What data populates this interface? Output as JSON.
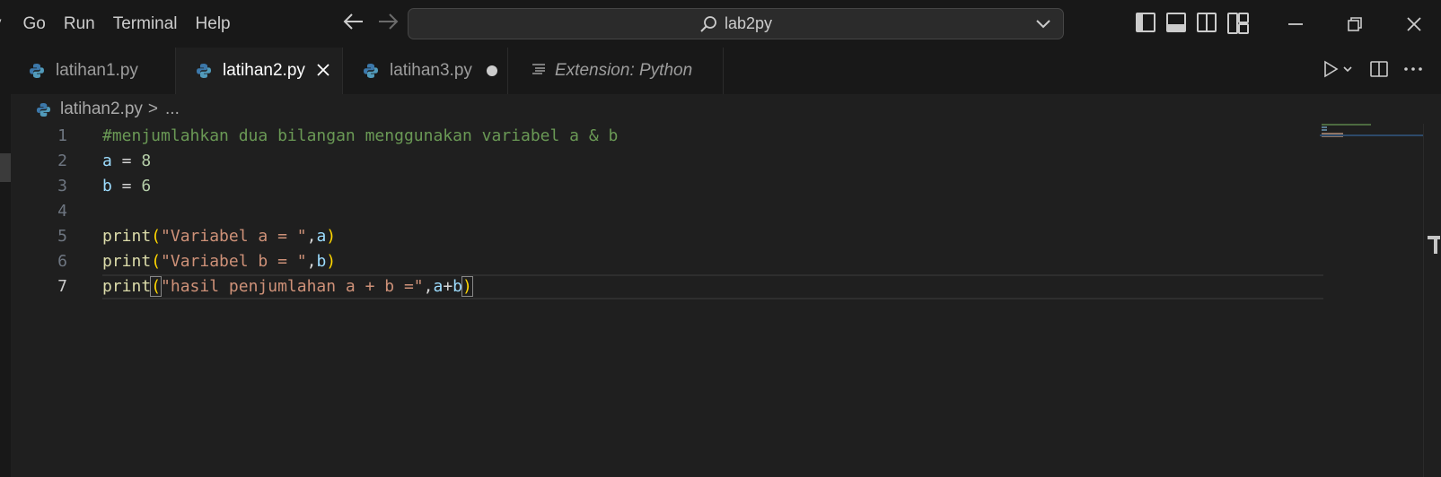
{
  "menu": {
    "items": [
      "y",
      "Go",
      "Run",
      "Terminal",
      "Help"
    ]
  },
  "nav": {
    "back_icon": "arrow-left-icon",
    "forward_icon": "arrow-right-icon"
  },
  "command_center": {
    "text": "lab2py",
    "icon": "search-icon"
  },
  "tabs": [
    {
      "label": "latihan1.py",
      "icon": "python-icon",
      "active": false
    },
    {
      "label": "latihan2.py",
      "icon": "python-icon",
      "active": true,
      "close": "×"
    },
    {
      "label": "latihan3.py",
      "icon": "python-icon",
      "active": false,
      "dirty": true
    },
    {
      "label": "Extension: Python",
      "icon": "preview-icon",
      "active": false
    }
  ],
  "breadcrumb": {
    "file": "latihan2.py",
    "separator": ">",
    "more": "..."
  },
  "editor": {
    "line_numbers": [
      "1",
      "2",
      "3",
      "4",
      "5",
      "6",
      "7"
    ],
    "current_line": 7
  },
  "colors": {
    "background": "#1f1f1f",
    "titlebar": "#181818",
    "comment": "#6a9955",
    "variable": "#9cdcfe",
    "function": "#dcdcaa",
    "string": "#ce9178",
    "number": "#b5cea8",
    "bracket": "#ffd700",
    "python_blue": "#3c78aa",
    "python_yellow": "#519aba"
  }
}
